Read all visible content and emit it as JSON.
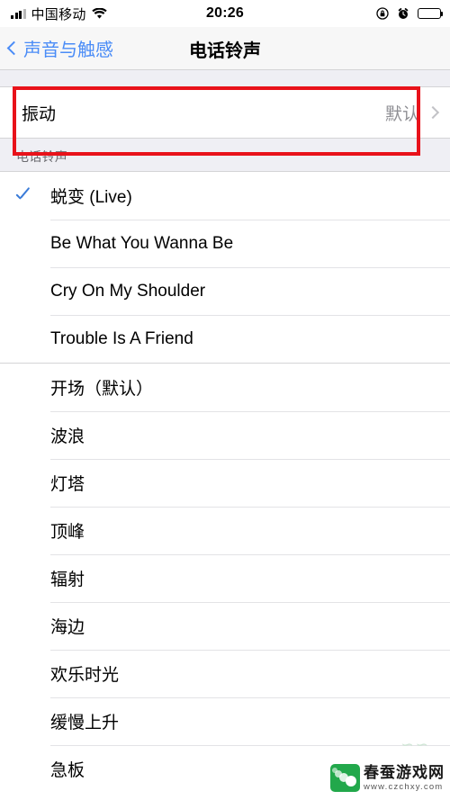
{
  "status_bar": {
    "carrier": "中国移动",
    "time": "20:26",
    "signal_icon": "signal-bars-icon",
    "wifi_icon": "wifi-icon",
    "rotation_lock_icon": "rotation-lock-icon",
    "alarm_icon": "alarm-clock-icon",
    "battery_icon": "battery-icon"
  },
  "nav": {
    "back_label": "声音与触感",
    "back_icon": "chevron-left-icon",
    "title": "电话铃声"
  },
  "vibration": {
    "label": "振动",
    "value": "默认",
    "chevron_icon": "chevron-right-icon"
  },
  "section": {
    "header": "电话铃声"
  },
  "custom_tones": [
    {
      "label": "蜕变 (Live)",
      "selected": true
    },
    {
      "label": "Be What You Wanna Be",
      "selected": false
    },
    {
      "label": "Cry On My Shoulder",
      "selected": false
    },
    {
      "label": "Trouble Is A Friend",
      "selected": false
    }
  ],
  "default_tones": [
    {
      "label": "开场（默认）",
      "selected": false
    },
    {
      "label": "波浪",
      "selected": false
    },
    {
      "label": "灯塔",
      "selected": false
    },
    {
      "label": "顶峰",
      "selected": false
    },
    {
      "label": "辐射",
      "selected": false
    },
    {
      "label": "海边",
      "selected": false
    },
    {
      "label": "欢乐时光",
      "selected": false
    },
    {
      "label": "缓慢上升",
      "selected": false
    },
    {
      "label": "急板",
      "selected": false
    }
  ],
  "highlight": {
    "color": "#e8121a",
    "target": "振动"
  },
  "watermark": {
    "faint_text": "∽∽",
    "site_name": "春蚕游戏网",
    "url": "www.czchxy.com",
    "logo_icon": "silkworm-logo-icon"
  }
}
